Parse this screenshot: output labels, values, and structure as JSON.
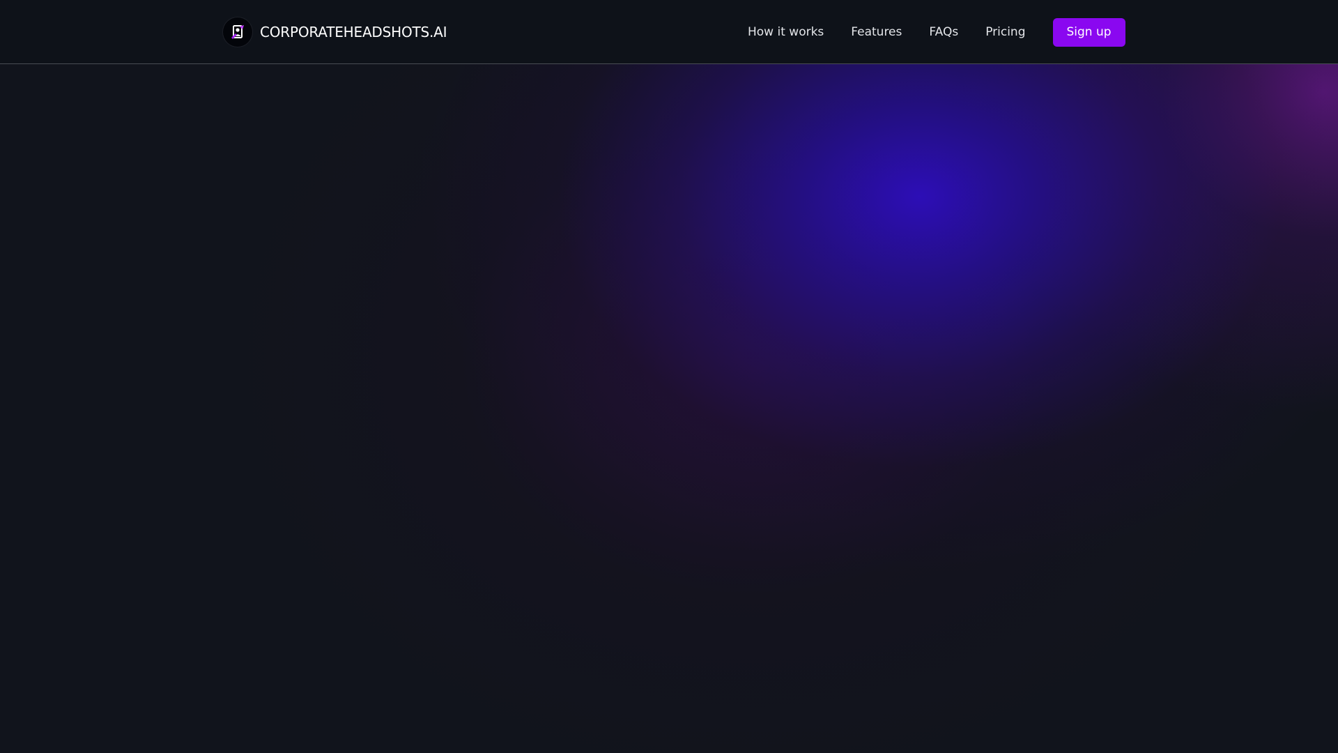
{
  "header": {
    "brand_name": "CORPORATEHEADSHOTS.AI",
    "logo_icon": "headshot-logo-icon",
    "nav_links": [
      {
        "label": "How it works"
      },
      {
        "label": "Features"
      },
      {
        "label": "FAQs"
      },
      {
        "label": "Pricing"
      }
    ],
    "signup_label": "Sign up"
  },
  "colors": {
    "background": "#11141c",
    "navbar": "#0e1219",
    "accent": "#8a08f0",
    "glow_blue": "#2e0ebe",
    "glow_magenta": "#7818a0"
  }
}
